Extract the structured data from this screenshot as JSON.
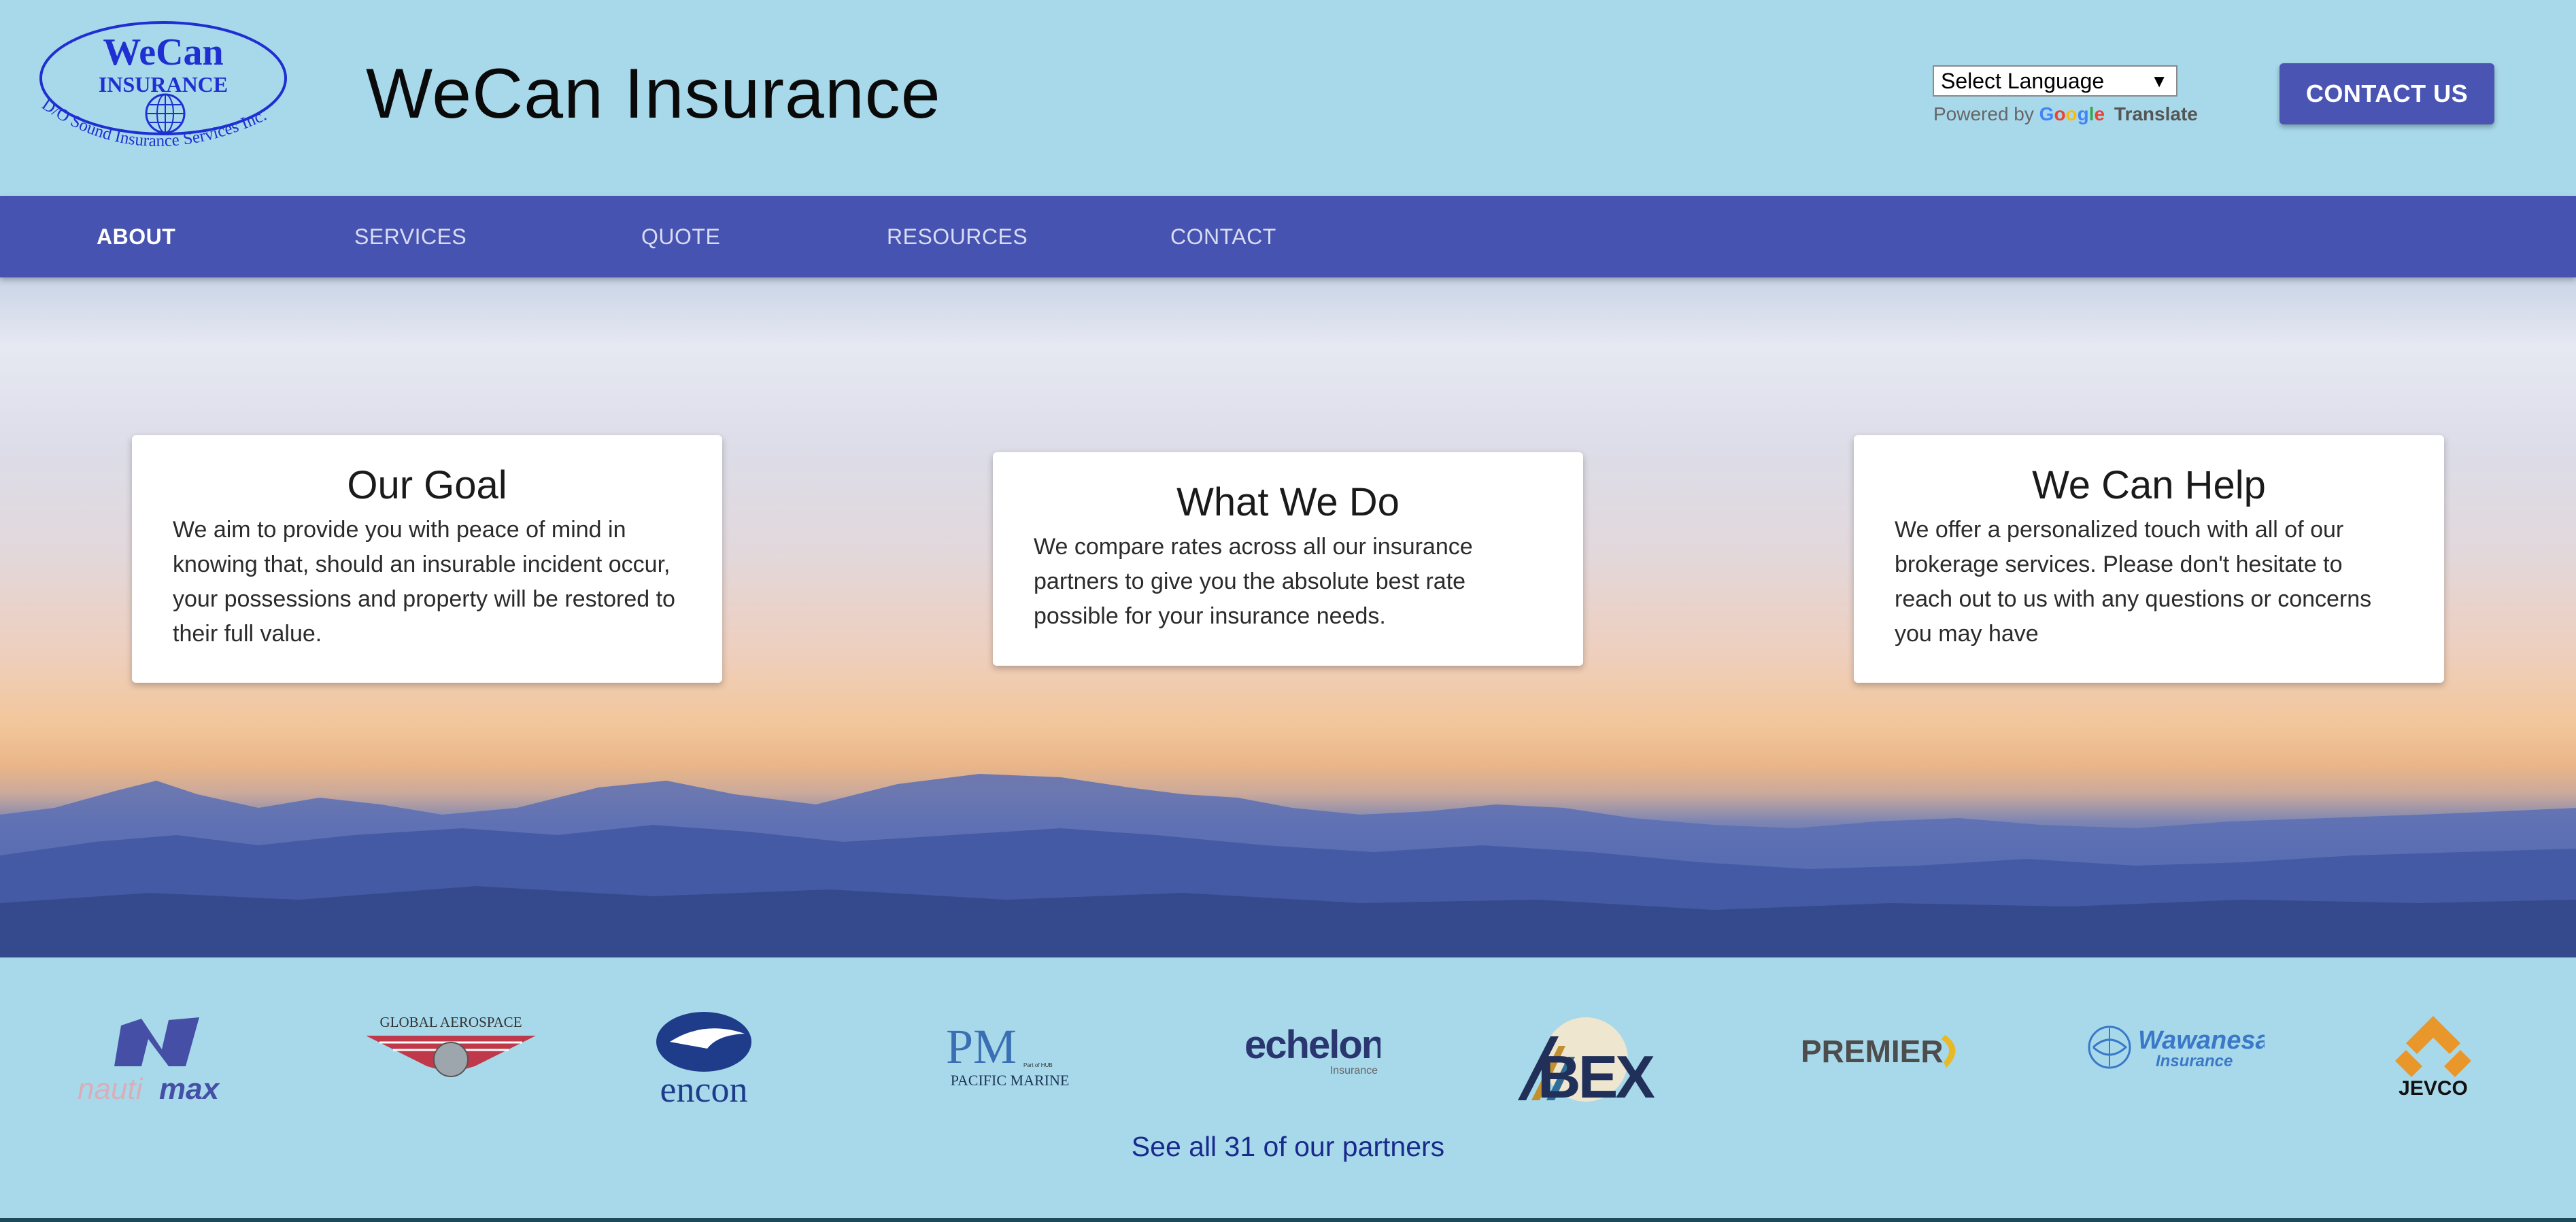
{
  "header": {
    "logo": {
      "line1": "WeCan",
      "line2": "INSURANCE",
      "arc": "D/O Sound Insurance Services Inc."
    },
    "title": "WeCan Insurance",
    "language_select": {
      "selected": "Select Language"
    },
    "powered_by": {
      "prefix": "Powered by",
      "brand": "Google",
      "suffix": "Translate"
    },
    "contact_button": "CONTACT US"
  },
  "nav": {
    "items": [
      {
        "label": "ABOUT",
        "active": true
      },
      {
        "label": "SERVICES",
        "active": false
      },
      {
        "label": "QUOTE",
        "active": false
      },
      {
        "label": "RESOURCES",
        "active": false
      },
      {
        "label": "CONTACT",
        "active": false
      }
    ]
  },
  "hero": {
    "cards": [
      {
        "title": "Our Goal",
        "body": "We aim to provide you with peace of mind in knowing that, should an insurable incident occur, your possessions and property will be restored to their full value."
      },
      {
        "title": "What We Do",
        "body": "We compare rates across all our insurance partners to give you the absolute best rate possible for your insurance needs."
      },
      {
        "title": "We Can Help",
        "body": "We offer a personalized touch with all of our brokerage services. Please don't hesitate to reach out to us with any questions or concerns you may have"
      }
    ]
  },
  "partners": {
    "logos": [
      {
        "name": "nautimax",
        "text_a": "nauti",
        "text_b": "max"
      },
      {
        "name": "global-aerospace",
        "text": "GLOBAL AEROSPACE"
      },
      {
        "name": "encon",
        "text": "encon"
      },
      {
        "name": "pacific-marine",
        "mark": "PM",
        "text": "PACIFIC MARINE",
        "small": "Part of HUB"
      },
      {
        "name": "echelon",
        "text": "echelon",
        "sub": "Insurance"
      },
      {
        "name": "abex",
        "text": "BEX",
        "initial": "A"
      },
      {
        "name": "premier",
        "text": "PREMIER"
      },
      {
        "name": "wawanesa",
        "text": "Wawanesa",
        "sub": "Insurance"
      },
      {
        "name": "jevco",
        "text": "JEVCO"
      }
    ],
    "see_all": "See all 31 of our partners"
  },
  "colors": {
    "header_bg": "#a8d9eb",
    "nav_bg": "#4753b0",
    "button_bg": "#4a55b3",
    "logo_blue": "#1f2fd1",
    "link": "#1a2a8c"
  }
}
